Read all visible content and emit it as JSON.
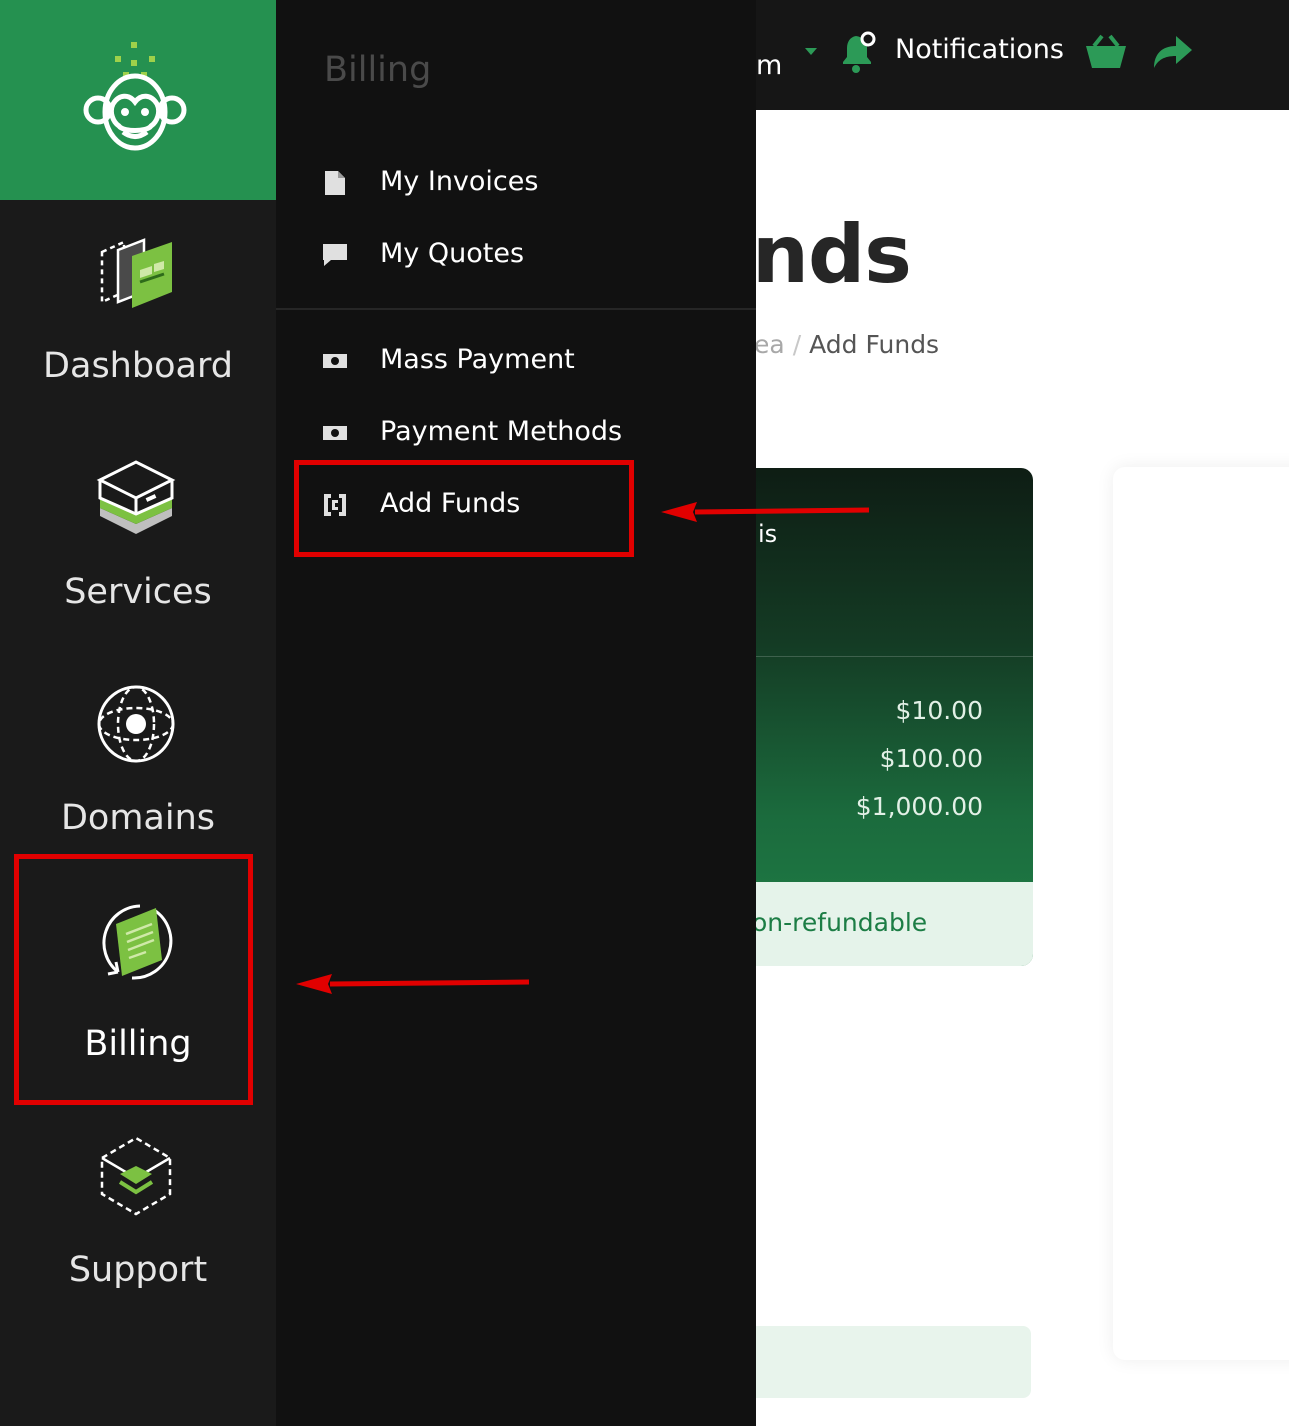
{
  "topbar": {
    "partial_text": "m",
    "notifications_label": "Notifications",
    "icons": [
      "caret-down-icon",
      "bell-icon",
      "basket-icon",
      "share-icon"
    ],
    "accent": "#2c9a57"
  },
  "page": {
    "title_partial": "nds",
    "breadcrumb_prev": "ea",
    "breadcrumb_sep": "/",
    "breadcrumb_current": "Add Funds"
  },
  "card": {
    "top_text": "is",
    "amounts": [
      "$10.00",
      "$100.00",
      "$1,000.00"
    ],
    "footer_text": "on-refundable"
  },
  "sidebar": {
    "brand_color": "#259150",
    "logo": "monkey-logo-icon",
    "items": [
      {
        "label": "Dashboard",
        "icon": "dashboard-icon"
      },
      {
        "label": "Services",
        "icon": "services-icon"
      },
      {
        "label": "Domains",
        "icon": "globe-icon"
      },
      {
        "label": "Billing",
        "icon": "billing-icon",
        "active": true
      },
      {
        "label": "Support",
        "icon": "support-icon"
      }
    ]
  },
  "flyout": {
    "title": "Billing",
    "items": [
      {
        "label": "My Invoices",
        "icon": "file-icon"
      },
      {
        "label": "My Quotes",
        "icon": "comment-icon"
      },
      {
        "label": "Mass Payment",
        "icon": "money-icon"
      },
      {
        "label": "Payment Methods",
        "icon": "money-icon"
      },
      {
        "label": "Add Funds",
        "icon": "wallet-icon"
      }
    ]
  },
  "annotations": {
    "highlight_color": "#e10000",
    "highlights": [
      "add-funds",
      "billing"
    ]
  }
}
